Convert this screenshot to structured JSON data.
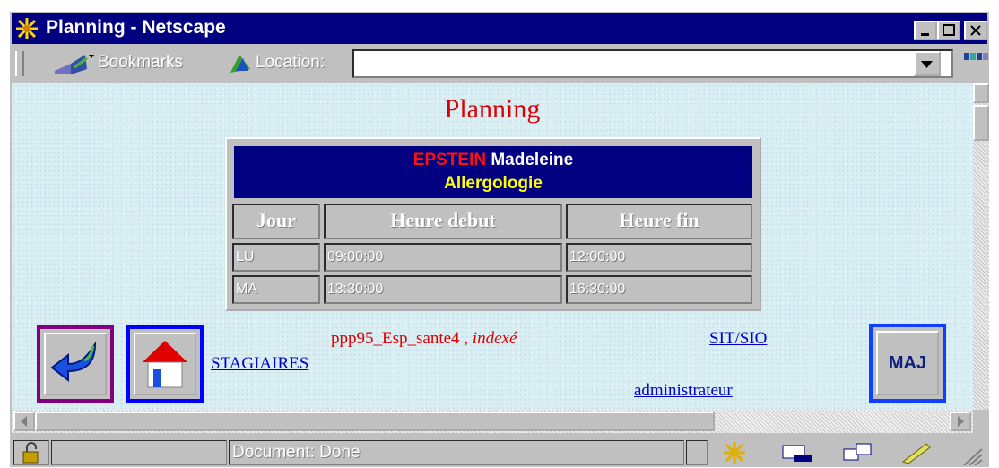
{
  "window": {
    "title": "Planning - Netscape",
    "icon": "netscape-star-icon"
  },
  "toolbar": {
    "bookmarks_label": "Bookmarks",
    "location_label": "Location:",
    "location_value": ""
  },
  "page": {
    "heading": "Planning",
    "doctor": {
      "last_name": "EPSTEIN",
      "first_name": "Madeleine",
      "specialty": "Allergologie"
    },
    "table": {
      "headers": [
        "Jour",
        "Heure debut",
        "Heure fin"
      ],
      "rows": [
        [
          "LU",
          "09:00:00",
          "12:00:00"
        ],
        [
          "MA",
          "13:30:00",
          "16:30:00"
        ]
      ]
    },
    "footer": {
      "code": "ppp95_Esp_sante4",
      "comma": ",",
      "status": "indexé",
      "link_sit": "SIT/SIO",
      "link_stagiaires": "STAGIAIRES",
      "link_admin": "administrateur",
      "maj_label": "MAJ"
    }
  },
  "statusbar": {
    "text": "Document: Done"
  },
  "colors": {
    "titlebar": "#000080",
    "heading": "#dd0000",
    "link": "#0000cc",
    "back_border": "#800080",
    "home_border": "#0000ff"
  }
}
